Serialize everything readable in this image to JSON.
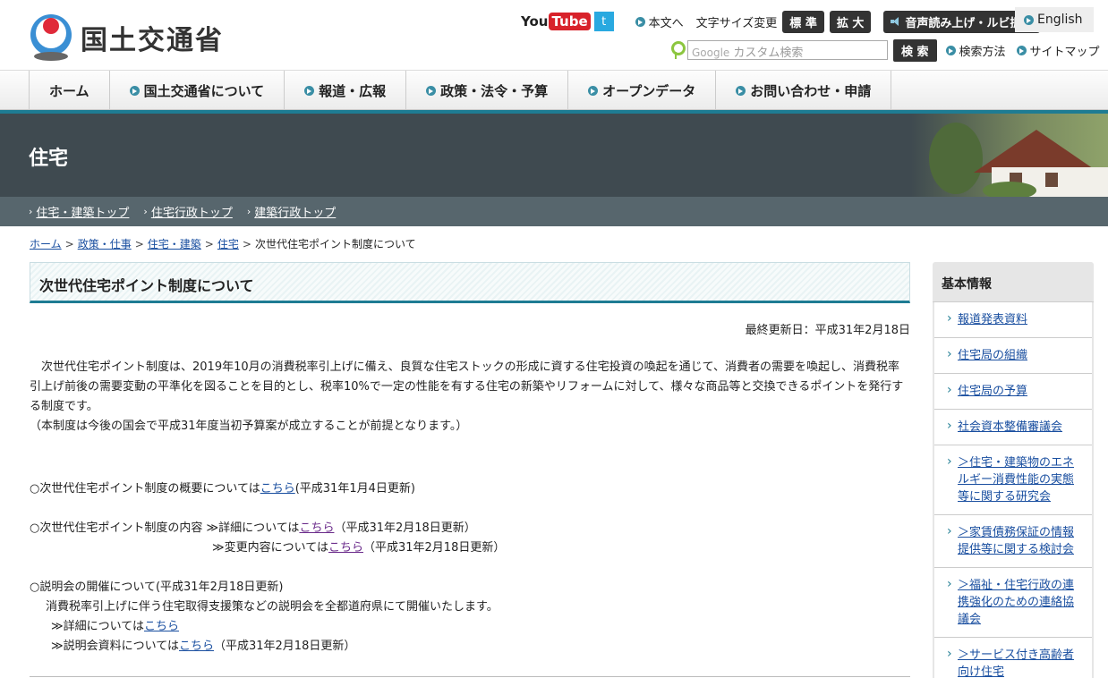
{
  "header": {
    "logo_text": "国土交通省",
    "youtube_you": "You",
    "youtube_tube": "Tube",
    "twitter": "t",
    "skip_link": "本文へ",
    "font_size_label": "文字サイズ変更",
    "font_standard": "標 準",
    "font_large": "拡 大",
    "read_aloud": "音声読み上げ・ルビ振り",
    "english": "English",
    "search_google": "Google",
    "search_placeholder": "カスタム検索",
    "search_button": "検 索",
    "search_method": "検索方法",
    "sitemap": "サイトマップ"
  },
  "nav": {
    "items": [
      "ホーム",
      "国土交通省について",
      "報道・広報",
      "政策・法令・予算",
      "オープンデータ",
      "お問い合わせ・申請"
    ]
  },
  "banner": {
    "title": "住宅"
  },
  "subnav": {
    "items": [
      "住宅・建築トップ",
      "住宅行政トップ",
      "建築行政トップ"
    ]
  },
  "breadcrumb": {
    "items": [
      "ホーム",
      "政策・仕事",
      "住宅・建築",
      "住宅"
    ],
    "current": "次世代住宅ポイント制度について",
    "sep": ">"
  },
  "main": {
    "title": "次世代住宅ポイント制度について",
    "updated": "最終更新日：平成31年2月18日",
    "para1": "　次世代住宅ポイント制度は、2019年10月の消費税率引上げに備え、良質な住宅ストックの形成に資する住宅投資の喚起を通じて、消費者の需要を喚起し、消費税率引上げ前後の需要変動の平準化を図ることを目的とし、税率10%で一定の性能を有する住宅の新築やリフォームに対して、様々な商品等と交換できるポイントを発行する制度です。",
    "para2": "（本制度は今後の国会で平成31年度当初予算案が成立することが前提となります。）",
    "l1_pre": "○次世代住宅ポイント制度の概要については",
    "l1_link": "こちら",
    "l1_post": "(平成31年1月4日更新)",
    "l2_pre": "○次世代住宅ポイント制度の内容 ≫詳細については",
    "l2_link": "こちら",
    "l2_post": "（平成31年2月18日更新）",
    "l3_pre": "≫変更内容については",
    "l3_link": "こちら",
    "l3_post": "（平成31年2月18日更新）",
    "l4": "○説明会の開催について(平成31年2月18日更新)",
    "l5": "消費税率引上げに伴う住宅取得支援策などの説明会を全都道府県にて開催いたします。",
    "l6_pre": "≫詳細については",
    "l6_link": "こちら",
    "l7_pre": "≫説明会資料については",
    "l7_link": "こちら",
    "l7_post": "（平成31年2月18日更新）"
  },
  "sidebar": {
    "title": "基本情報",
    "items": [
      "報道発表資料",
      "住宅局の組織",
      "住宅局の予算",
      "社会資本整備審議会",
      "＞住宅・建築物のエネルギー消費性能の実態等に関する研究会",
      "＞家賃債務保証の情報提供等に関する検討会",
      "＞福祉・住宅行政の連携強化のための連絡協議会",
      "＞サービス付き高齢者向け住宅"
    ]
  },
  "colors": {
    "teal": "#1e7c93",
    "banner": "#3f4a50",
    "subnav": "#57666d",
    "link": "#1a4fa0"
  }
}
